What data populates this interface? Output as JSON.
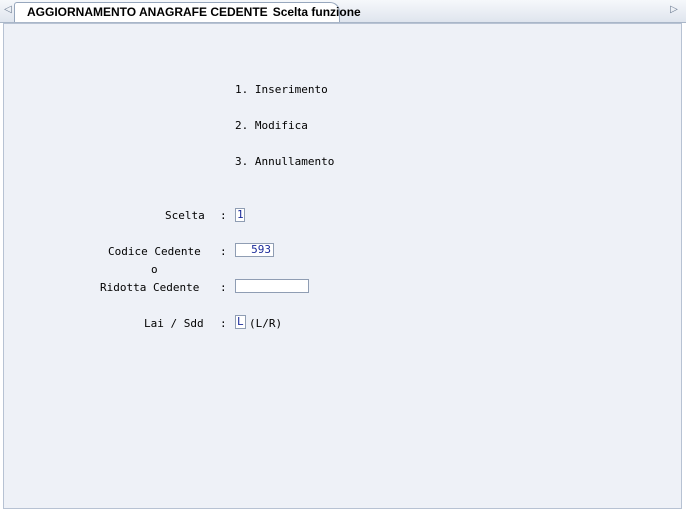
{
  "tab": {
    "title": "AGGIORNAMENTO ANAGRAFE CEDENTE",
    "subtitle": "Scelta funzione"
  },
  "nav": {
    "left_icon": "triangle-left",
    "right_icon": "triangle-right"
  },
  "menu": {
    "items": [
      {
        "label": "1. Inserimento"
      },
      {
        "label": "2. Modifica"
      },
      {
        "label": "3. Annullamento"
      }
    ]
  },
  "form": {
    "scelta": {
      "label": "Scelta",
      "value": "1"
    },
    "codice_cedente": {
      "label": "Codice Cedente",
      "value": "593"
    },
    "oppure": "o",
    "ridotta_cedente": {
      "label": "Ridotta Cedente",
      "value": ""
    },
    "lai_sdd": {
      "label": "Lai / Sdd",
      "value": "L",
      "hint": "(L/R)"
    },
    "separator": ":"
  }
}
